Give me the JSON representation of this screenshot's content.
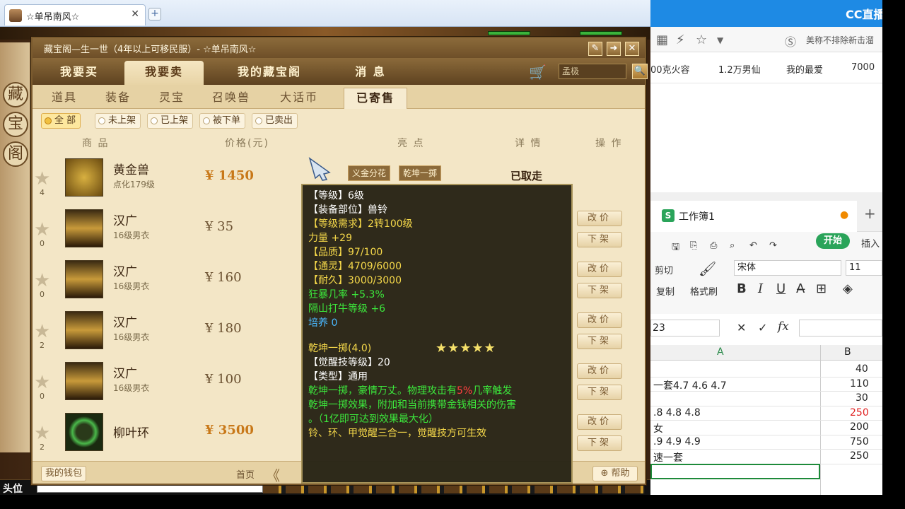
{
  "browser": {
    "tab_title": "☆单吊南风☆",
    "close": "✕",
    "new_tab": "+"
  },
  "window": {
    "title": "藏宝阁—生一世（4年以上可移民服）- ☆单吊南风☆",
    "btn_edit": "✎",
    "btn_arrow": "➜",
    "btn_close": "✕",
    "side_chars": [
      "藏",
      "宝",
      "阁"
    ]
  },
  "main_tabs": [
    "我要买",
    "我要卖",
    "我的藏宝阁",
    "消 息"
  ],
  "search": {
    "value": "孟极",
    "cart": "🛒",
    "btn": "🔍"
  },
  "sub_tabs": [
    "道具",
    "装备",
    "灵宝",
    "召唤兽",
    "大话币",
    "已寄售"
  ],
  "filters": [
    "全 部",
    "未上架",
    "已上架",
    "被下单",
    "已卖出"
  ],
  "table_headers": {
    "item": "商 品",
    "price": "价格(元)",
    "highlight": "亮 点",
    "detail": "详 情",
    "op": "操 作"
  },
  "rows": [
    {
      "name": "黄金兽",
      "sub": "点化179级",
      "count": "4",
      "price": "¥ 1450",
      "status": "已取走",
      "tag1": "义金分花",
      "tag2": "乾坤一掷"
    },
    {
      "name": "汉广",
      "sub": "16级男衣",
      "count": "0",
      "price": "¥ 35",
      "btn1": "改价",
      "btn2": "下架"
    },
    {
      "name": "汉广",
      "sub": "16级男衣",
      "count": "0",
      "price": "¥ 160",
      "btn1": "改价",
      "btn2": "下架"
    },
    {
      "name": "汉广",
      "sub": "16级男衣",
      "count": "2",
      "price": "¥ 180",
      "btn1": "改价",
      "btn2": "下架"
    },
    {
      "name": "汉广",
      "sub": "16级男衣",
      "count": "0",
      "price": "¥ 100",
      "btn1": "改价",
      "btn2": "下架"
    },
    {
      "name": "柳叶环",
      "sub": "",
      "count": "2",
      "price": "¥ 3500",
      "btn1": "改价",
      "btn2": "下架"
    }
  ],
  "footer": {
    "wallet": "我的钱包",
    "home": "首页",
    "prev": "《",
    "help": "⊕ 帮助"
  },
  "tooltip": {
    "lines": [
      {
        "text": "【等级】6级",
        "color": "w"
      },
      {
        "text": "【装备部位】兽铃",
        "color": "w"
      },
      {
        "text": "【等级需求】2转100级",
        "color": "y"
      },
      {
        "text": "力量 +29",
        "color": "y"
      },
      {
        "text": "【品质】97/100",
        "color": "y"
      },
      {
        "text": "【通灵】4709/6000",
        "color": "y"
      },
      {
        "text": "【耐久】3000/3000",
        "color": "y"
      },
      {
        "text": "狂暴几率 +5.3%",
        "color": "g"
      },
      {
        "text": "隔山打牛等级 +6",
        "color": "g"
      },
      {
        "text": "培养 0",
        "color": "b"
      },
      {
        "text": "乾坤一掷(4.0)",
        "color": "y"
      },
      {
        "text": "【觉醒技等级】20",
        "color": "w"
      },
      {
        "text": "【类型】通用",
        "color": "w"
      },
      {
        "text": "乾坤一掷，豪情万丈。物理攻击有",
        "color": "g"
      },
      {
        "text": "乾坤一掷效果，附加和当前携带金钱相关的伤害",
        "color": "g"
      },
      {
        "text": "。（1亿即可达到效果最大化）",
        "color": "g"
      },
      {
        "text": "铃、环、甲觉醒三合一，觉醒技方可生效",
        "color": "y"
      }
    ],
    "inline_red": "5%",
    "inline_tail": "几率触发",
    "stars": "★★★★★"
  },
  "right": {
    "cc_logo": "CC直播",
    "search_hint": "美称不排除新击溜",
    "bookmarks": [
      "00克火容",
      "1.2万男仙",
      "我的最爱",
      "7000"
    ],
    "sheet_tab": "工作簿1",
    "sheet_dot": "●",
    "plus": "+",
    "start": "开始",
    "insert": "插入",
    "cut": "剪切",
    "copy": "复制",
    "fmt_brush": "格式刷",
    "font": "宋体",
    "font_size": "11",
    "name_box": "23",
    "col_a": "A",
    "col_b": "B",
    "cells": [
      {
        "a": "",
        "b": "40"
      },
      {
        "a": "一套4.7 4.6 4.7",
        "b": "110"
      },
      {
        "a": "",
        "b": "30"
      },
      {
        "a": ".8 4.8 4.8",
        "b": "250",
        "red": true
      },
      {
        "a": "女",
        "b": "200"
      },
      {
        "a": ".9 4.9 4.9",
        "b": "750"
      },
      {
        "a": "速一套",
        "b": "250"
      }
    ]
  },
  "chat": {
    "label": "头位"
  }
}
